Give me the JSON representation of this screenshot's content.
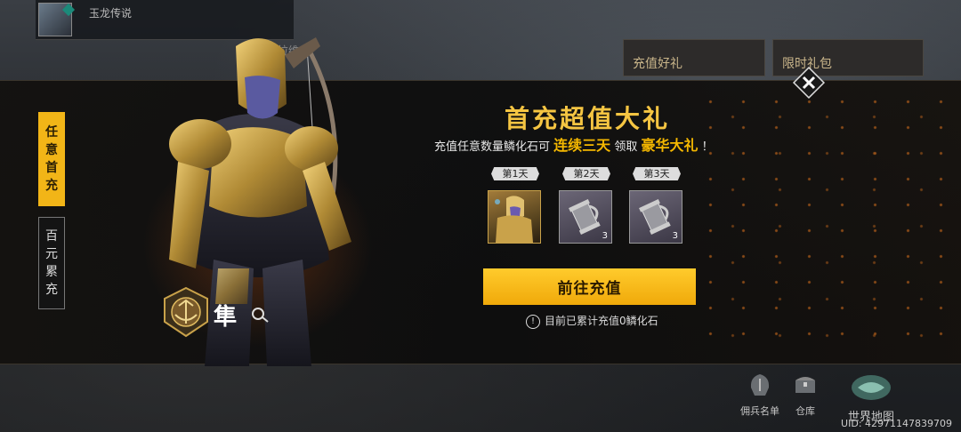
{
  "player": {
    "name": "玉龙传说"
  },
  "ghost_label": "古拉维",
  "banners": [
    {
      "label": "充值好礼"
    },
    {
      "label": "限时礼包"
    }
  ],
  "tabs": [
    {
      "label": "任\n意\n首\n充"
    },
    {
      "label": "百\n元\n累\n充"
    }
  ],
  "hero": {
    "name": "隼"
  },
  "offer": {
    "title": "首充超值大礼",
    "subtitle_prefix": "充值任意数量鳞化石可",
    "subtitle_highlight_1": "连续三天",
    "subtitle_mid": "领取",
    "subtitle_highlight_2": "豪华大礼",
    "subtitle_suffix": "！",
    "days": [
      {
        "label": "第1天",
        "item": "hero-icon",
        "qty": ""
      },
      {
        "label": "第2天",
        "item": "tankard-icon",
        "qty": "3"
      },
      {
        "label": "第3天",
        "item": "tankard-icon",
        "qty": "3"
      }
    ],
    "button_label": "前往充值",
    "notice": "目前已累计充值0鳞化石"
  },
  "hud": [
    {
      "label": "佣兵名单",
      "icon": "helmet-icon"
    },
    {
      "label": "仓库",
      "icon": "chest-icon"
    },
    {
      "label": "世界地图",
      "icon": "world-map-icon"
    }
  ],
  "uid": "UID: 4297114783970​9",
  "colors": {
    "accent": "#f5b800",
    "tab_active": "#f2b517"
  }
}
